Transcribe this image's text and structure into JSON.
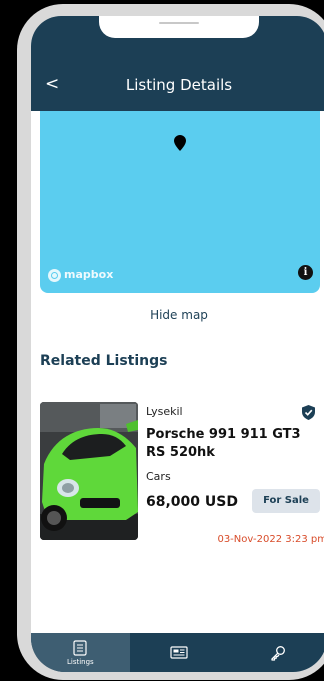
{
  "header": {
    "back_glyph": "<",
    "title": "Listing Details"
  },
  "map": {
    "logo_text": "mapbox",
    "info_glyph": "i",
    "background_color": "#5bcdef"
  },
  "hide_map_label": "Hide map",
  "related": {
    "title": "Related Listings",
    "items": [
      {
        "location": "Lysekil",
        "name": "Porsche 991 911 GT3 RS 520hk",
        "category": "Cars",
        "price": "68,000 USD",
        "status": "For Sale",
        "date": "03-Nov-2022 3:23 pm",
        "verified_icon": "shield-check-icon"
      }
    ]
  },
  "tabs": [
    {
      "label": "Listings",
      "icon": "listings-icon",
      "active": true
    },
    {
      "label": "",
      "icon": "newspaper-icon",
      "active": false
    },
    {
      "label": "",
      "icon": "key-icon",
      "active": false
    }
  ],
  "colors": {
    "primary": "#1c3f55",
    "active_tab": "#3e5e72",
    "accent_date": "#d84c2a",
    "badge_bg": "#dde3ea"
  }
}
